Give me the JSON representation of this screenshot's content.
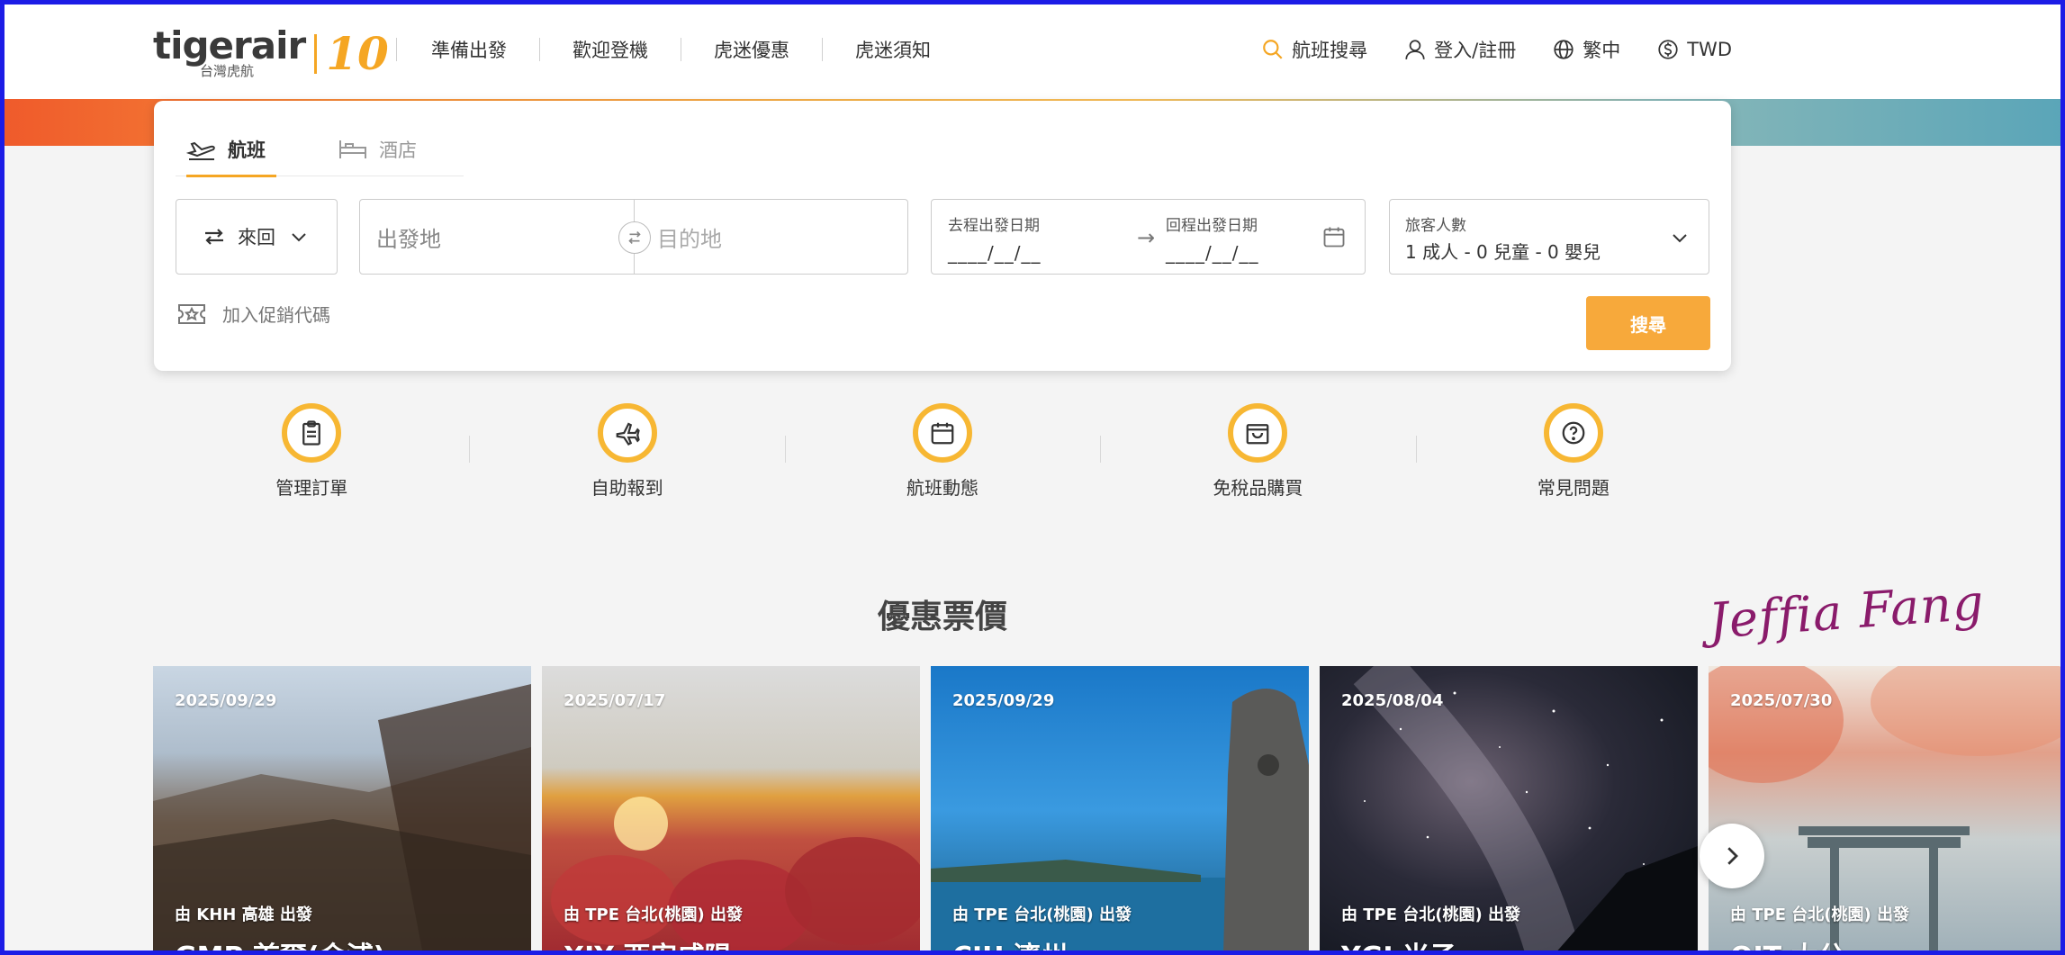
{
  "brand": {
    "logo_text": "tigerair",
    "logo_sub": "台灣虎航",
    "anniversary": "10",
    "colors": {
      "accent": "#f5a623",
      "button": "#f7a93b",
      "frame": "#1c1ce6"
    }
  },
  "nav": {
    "items": [
      "準備出發",
      "歡迎登機",
      "虎迷優惠",
      "虎迷須知"
    ],
    "flight_search": "航班搜尋",
    "login": "登入/註冊",
    "language": "繁中",
    "currency": "TWD"
  },
  "search": {
    "tabs": [
      {
        "label": "航班",
        "active": true,
        "icon": "plane-icon"
      },
      {
        "label": "酒店",
        "active": false,
        "icon": "bed-icon"
      }
    ],
    "trip_type": "來回",
    "origin_placeholder": "出發地",
    "destination_placeholder": "目的地",
    "depart_label": "去程出發日期",
    "depart_value": "____/__/__",
    "return_label": "回程出發日期",
    "return_value": "____/__/__",
    "pax_label": "旅客人數",
    "pax_value": "1 成人 - 0 兒童 - 0 嬰兒",
    "promo_label": "加入促銷代碼",
    "search_button": "搜尋"
  },
  "quick_links": [
    {
      "label": "管理訂單",
      "icon": "clipboard-icon"
    },
    {
      "label": "自助報到",
      "icon": "airplane-icon"
    },
    {
      "label": "航班動態",
      "icon": "calendar-icon"
    },
    {
      "label": "免稅品購買",
      "icon": "shopping-bag-icon"
    },
    {
      "label": "常見問題",
      "icon": "question-icon"
    }
  ],
  "deals_title": "優惠票價",
  "signature": "Jeffia Fang",
  "deals": [
    {
      "date": "2025/09/29",
      "origin": "由 KHH 高雄 出發",
      "destination": "GMP 首爾(金浦)"
    },
    {
      "date": "2025/07/17",
      "origin": "由 TPE 台北(桃園) 出發",
      "destination": "XIY 西安咸陽"
    },
    {
      "date": "2025/09/29",
      "origin": "由 TPE 台北(桃園) 出發",
      "destination": "CJU 濟州"
    },
    {
      "date": "2025/08/04",
      "origin": "由 TPE 台北(桃園) 出發",
      "destination": "YGJ 米子"
    },
    {
      "date": "2025/07/30",
      "origin": "由 TPE 台北(桃園) 出發",
      "destination": "OIT 大分"
    }
  ]
}
